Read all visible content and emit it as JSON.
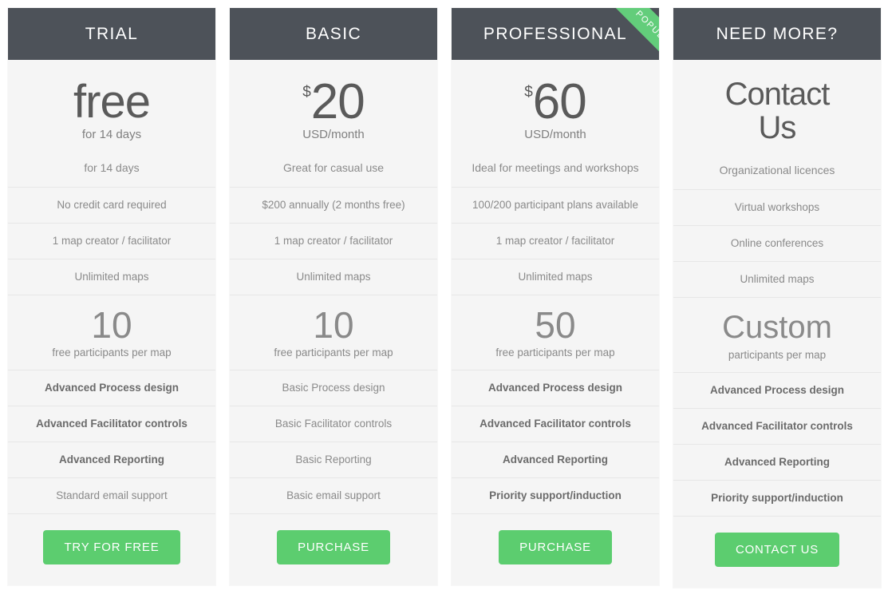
{
  "ribbon": {
    "label": "POPULAR"
  },
  "colors": {
    "header_bg": "#4d5259",
    "card_bg": "#f5f5f5",
    "accent_green": "#5ccd6f",
    "ribbon_green": "#63cd7b",
    "text_muted": "#8a8a8a"
  },
  "plans": [
    {
      "title": "TRIAL",
      "popular": false,
      "currency": "",
      "amount": "free",
      "period": "for 14 days",
      "tagline": "for 14 days",
      "features": [
        {
          "text": "No credit card required",
          "bold": false
        },
        {
          "text": "1 map creator / facilitator",
          "bold": false
        },
        {
          "text": "Unlimited maps",
          "bold": false
        }
      ],
      "participants_number": "10",
      "participants_label": "free participants per map",
      "features_bottom": [
        {
          "text": "Advanced Process design",
          "bold": true
        },
        {
          "text": "Advanced Facilitator controls",
          "bold": true
        },
        {
          "text": "Advanced Reporting",
          "bold": true
        },
        {
          "text": "Standard email support",
          "bold": false
        }
      ],
      "cta": "TRY FOR FREE"
    },
    {
      "title": "BASIC",
      "popular": false,
      "currency": "$",
      "amount": "20",
      "period": "USD/month",
      "tagline": "Great for casual use",
      "features": [
        {
          "text": "$200 annually (2 months free)",
          "bold": false
        },
        {
          "text": "1 map creator / facilitator",
          "bold": false
        },
        {
          "text": "Unlimited maps",
          "bold": false
        }
      ],
      "participants_number": "10",
      "participants_label": "free participants per map",
      "features_bottom": [
        {
          "text": "Basic Process design",
          "bold": false
        },
        {
          "text": "Basic Facilitator controls",
          "bold": false
        },
        {
          "text": "Basic Reporting",
          "bold": false
        },
        {
          "text": "Basic email support",
          "bold": false
        }
      ],
      "cta": "PURCHASE"
    },
    {
      "title": "PROFESSIONAL",
      "popular": true,
      "currency": "$",
      "amount": "60",
      "period": "USD/month",
      "tagline": "Ideal for meetings and workshops",
      "features": [
        {
          "text": "100/200 participant plans available",
          "bold": false
        },
        {
          "text": "1 map creator / facilitator",
          "bold": false
        },
        {
          "text": "Unlimited maps",
          "bold": false
        }
      ],
      "participants_number": "50",
      "participants_label": "free participants per map",
      "features_bottom": [
        {
          "text": "Advanced Process design",
          "bold": true
        },
        {
          "text": "Advanced Facilitator controls",
          "bold": true
        },
        {
          "text": "Advanced Reporting",
          "bold": true
        },
        {
          "text": "Priority support/induction",
          "bold": true
        }
      ],
      "cta": "PURCHASE"
    },
    {
      "title": "NEED MORE?",
      "popular": false,
      "currency": "",
      "amount": "Contact Us",
      "period": "",
      "tagline": "Organizational licences",
      "features": [
        {
          "text": "Virtual workshops",
          "bold": false
        },
        {
          "text": "Online conferences",
          "bold": false
        },
        {
          "text": "Unlimited maps",
          "bold": false
        }
      ],
      "participants_number": "Custom",
      "participants_label": "participants per map",
      "features_bottom": [
        {
          "text": "Advanced Process design",
          "bold": true
        },
        {
          "text": "Advanced Facilitator controls",
          "bold": true
        },
        {
          "text": "Advanced Reporting",
          "bold": true
        },
        {
          "text": "Priority support/induction",
          "bold": true
        }
      ],
      "cta": "CONTACT US"
    }
  ]
}
